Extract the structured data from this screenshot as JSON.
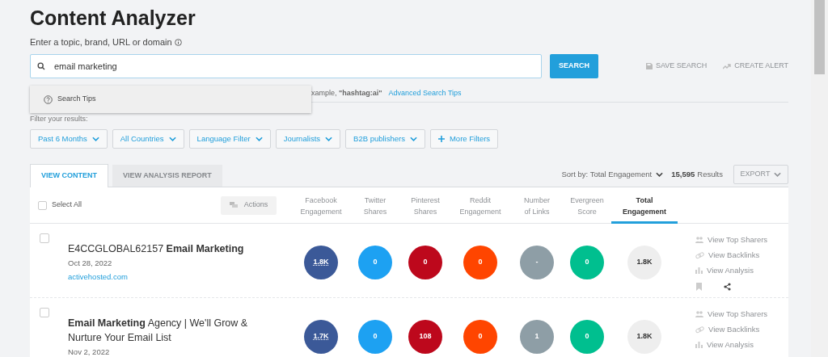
{
  "page": {
    "title": "Content Analyzer",
    "search_label": "Enter a topic, brand, URL or domain"
  },
  "search": {
    "value": "email marketing",
    "button": "SEARCH",
    "save": "SAVE SEARCH",
    "alert": "CREATE ALERT"
  },
  "suggestions": {
    "items": [
      "Search Tips"
    ],
    "hint": "xample, **\"hashtag:ai\"**",
    "hint_link": "Advanced Search Tips"
  },
  "filters": {
    "label": "Filter your results:",
    "items": [
      {
        "label": "Past 6 Months",
        "kind": "dropdown"
      },
      {
        "label": "All Countries",
        "kind": "dropdown"
      },
      {
        "label": "Language Filter",
        "kind": "dropdown"
      },
      {
        "label": "Journalists",
        "kind": "dropdown"
      },
      {
        "label": "B2B publishers",
        "kind": "dropdown"
      },
      {
        "label": "More Filters",
        "kind": "add"
      }
    ]
  },
  "tabs": [
    {
      "label": "VIEW CONTENT",
      "selected": true
    },
    {
      "label": "VIEW ANALYSIS REPORT",
      "selected": false
    }
  ],
  "toolbar": {
    "sort": "Sort by: Total Engagement",
    "results_count": "15,595",
    "results_label": "Results",
    "export": "EXPORT"
  },
  "table": {
    "select_all": "Select All",
    "select_all_checked": false,
    "actions": "Actions",
    "columns": [
      {
        "lines": [
          "Facebook",
          "Engagement"
        ],
        "color": "#3b5998",
        "selected": false
      },
      {
        "lines": [
          "Twitter",
          "Shares"
        ],
        "color": "#1da1f2",
        "selected": false
      },
      {
        "lines": [
          "Pinterest",
          "Shares"
        ],
        "color": "#bd081c",
        "selected": false
      },
      {
        "lines": [
          "Reddit",
          "Engagement"
        ],
        "color": "#ff4500",
        "selected": false
      },
      {
        "lines": [
          "Number",
          "of Links"
        ],
        "color": "#8e9ea6",
        "selected": false
      },
      {
        "lines": [
          "Evergreen",
          "Score"
        ],
        "color": "#00bf8f",
        "selected": false
      },
      {
        "lines": [
          "Total",
          "Engagement"
        ],
        "color": "#eeeeee",
        "selected": true
      }
    ],
    "rows": [
      {
        "checked": false,
        "title": "E4CCGLOBAL62157 **Email Marketing**",
        "date": "Oct 28, 2022",
        "domain": "activehosted.com",
        "values": [
          "1.8K",
          "0",
          "0",
          "0",
          "-",
          "0",
          "1.8K"
        ],
        "links": [
          "View Top Sharers",
          "View Backlinks",
          "View Analysis"
        ]
      },
      {
        "checked": false,
        "title": "**Email Marketing** Agency | We'll Grow & Nurture Your Email List",
        "date": "Nov 2, 2022",
        "values": [
          "1.7K",
          "0",
          "108",
          "0",
          "1",
          "0",
          "1.8K"
        ],
        "links": [
          "View Top Sharers",
          "View Backlinks",
          "View Analysis"
        ]
      }
    ]
  }
}
